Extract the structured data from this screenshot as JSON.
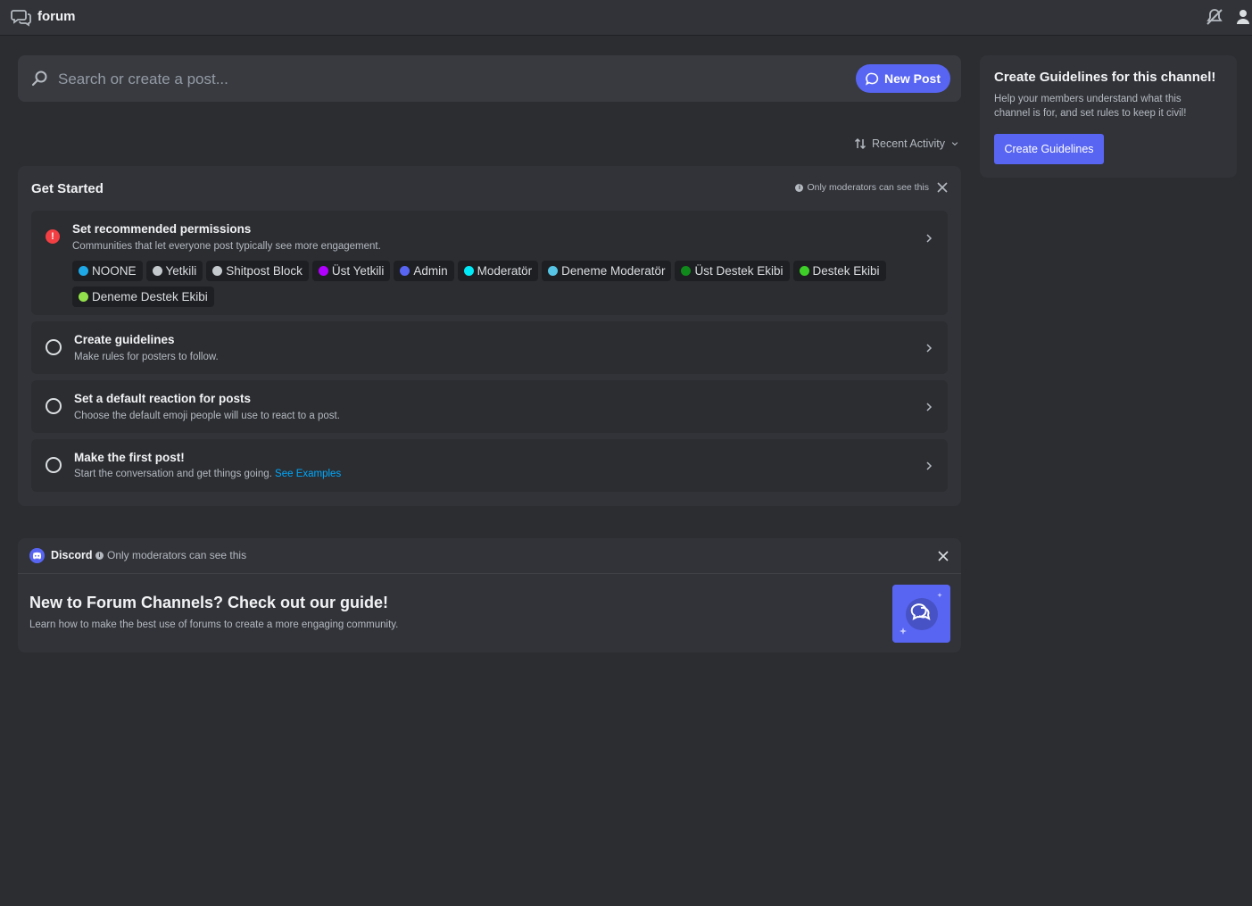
{
  "header": {
    "title": "forum",
    "icons": [
      "forum-channel-icon",
      "mute-notifications-icon",
      "members-icon"
    ]
  },
  "search": {
    "placeholder": "Search or create a post..."
  },
  "new_post": {
    "label": "New Post"
  },
  "sort": {
    "label": "Recent Activity"
  },
  "get_started": {
    "title": "Get Started",
    "moderator_note": "Only moderators can see this",
    "tasks": [
      {
        "title": "Set recommended permissions",
        "description": "Communities that let everyone post typically see more engagement.",
        "status": "warning",
        "roles": [
          {
            "name": "NOONE",
            "color": "#1ea8e6"
          },
          {
            "name": "Yetkili",
            "color": "#c4c9ce"
          },
          {
            "name": "Shitpost Block",
            "color": "#c4c9ce"
          },
          {
            "name": "Üst Yetkili",
            "color": "#b100ff"
          },
          {
            "name": "Admin",
            "color": "#5865f2"
          },
          {
            "name": "Moderatör",
            "color": "#00eaf8"
          },
          {
            "name": "Deneme Moderatör",
            "color": "#56c5e6"
          },
          {
            "name": "Üst Destek Ekibi",
            "color": "#0f8a1b"
          },
          {
            "name": "Destek Ekibi",
            "color": "#3ecf28"
          },
          {
            "name": "Deneme Destek Ekibi",
            "color": "#92e04b"
          }
        ]
      },
      {
        "title": "Create guidelines",
        "description": "Make rules for posters to follow.",
        "status": "incomplete"
      },
      {
        "title": "Set a default reaction for posts",
        "description": "Choose the default emoji people will use to react to a post.",
        "status": "incomplete"
      },
      {
        "title": "Make the first post!",
        "description": "Start the conversation and get things going.",
        "link": "See Examples",
        "status": "incomplete"
      }
    ]
  },
  "discord_tip": {
    "brand": "Discord",
    "moderator_note": "Only moderators can see this",
    "title": "New to Forum Channels? Check out our guide!",
    "description": "Learn how to make the best use of forums to create a more engaging community."
  },
  "guidelines_card": {
    "title": "Create Guidelines for this channel!",
    "description": "Help your members understand what this channel is for, and set rules to keep it civil!",
    "button": "Create Guidelines"
  },
  "colors": {
    "background": "#2b2d31",
    "panel": "#313338",
    "accent": "#5865f2",
    "danger": "#f23f43",
    "link": "#00a8fc"
  }
}
